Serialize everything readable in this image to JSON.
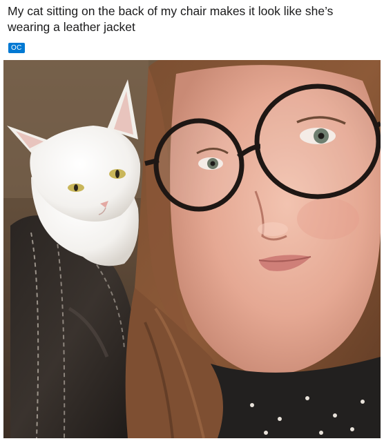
{
  "post": {
    "title": "My cat sitting on the back of my chair makes it look like she’s wearing a leather jacket",
    "flair": "OC"
  },
  "colors": {
    "flair_background": "#0079d3",
    "flair_text": "#ffffff",
    "title_text": "#1a1a1b"
  }
}
